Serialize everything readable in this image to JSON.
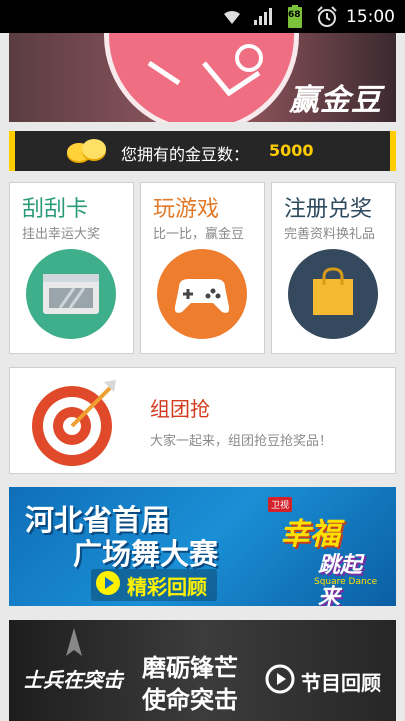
{
  "status_bar": {
    "time": "15:00",
    "battery": "68"
  },
  "banner": {
    "title": "赢金豆"
  },
  "coins": {
    "label": "您拥有的金豆数：",
    "value": "5000"
  },
  "cards": [
    {
      "title": "刮刮卡",
      "subtitle": "挂出幸运大奖",
      "title_color": "#2a9a78",
      "icon": "browser-window-icon"
    },
    {
      "title": "玩游戏",
      "subtitle": "比一比，赢金豆",
      "title_color": "#e07a2a",
      "icon": "gamepad-icon"
    },
    {
      "title": "注册兑奖",
      "subtitle": "完善资料换礼品",
      "title_color": "#2d4a5e",
      "icon": "shopping-bag-icon"
    }
  ],
  "group_buy": {
    "title": "组团抢",
    "subtitle": "大家一起来，组团抢豆抢奖品！"
  },
  "ad_dance": {
    "line1": "河北省首届",
    "line2": "广场舞大赛",
    "button": "精彩回顾",
    "logo_badge": "卫视",
    "logo_main": "幸福",
    "logo_sub": "跳起来",
    "logo_en": "Square Dance"
  },
  "ad_soldier": {
    "left_title": "士兵在突击",
    "line1": "磨砺锋芒",
    "line2": "使命突击",
    "button": "节目回顾"
  },
  "colors": {
    "accent": "#ffcc00",
    "red": "#d33b1f"
  }
}
